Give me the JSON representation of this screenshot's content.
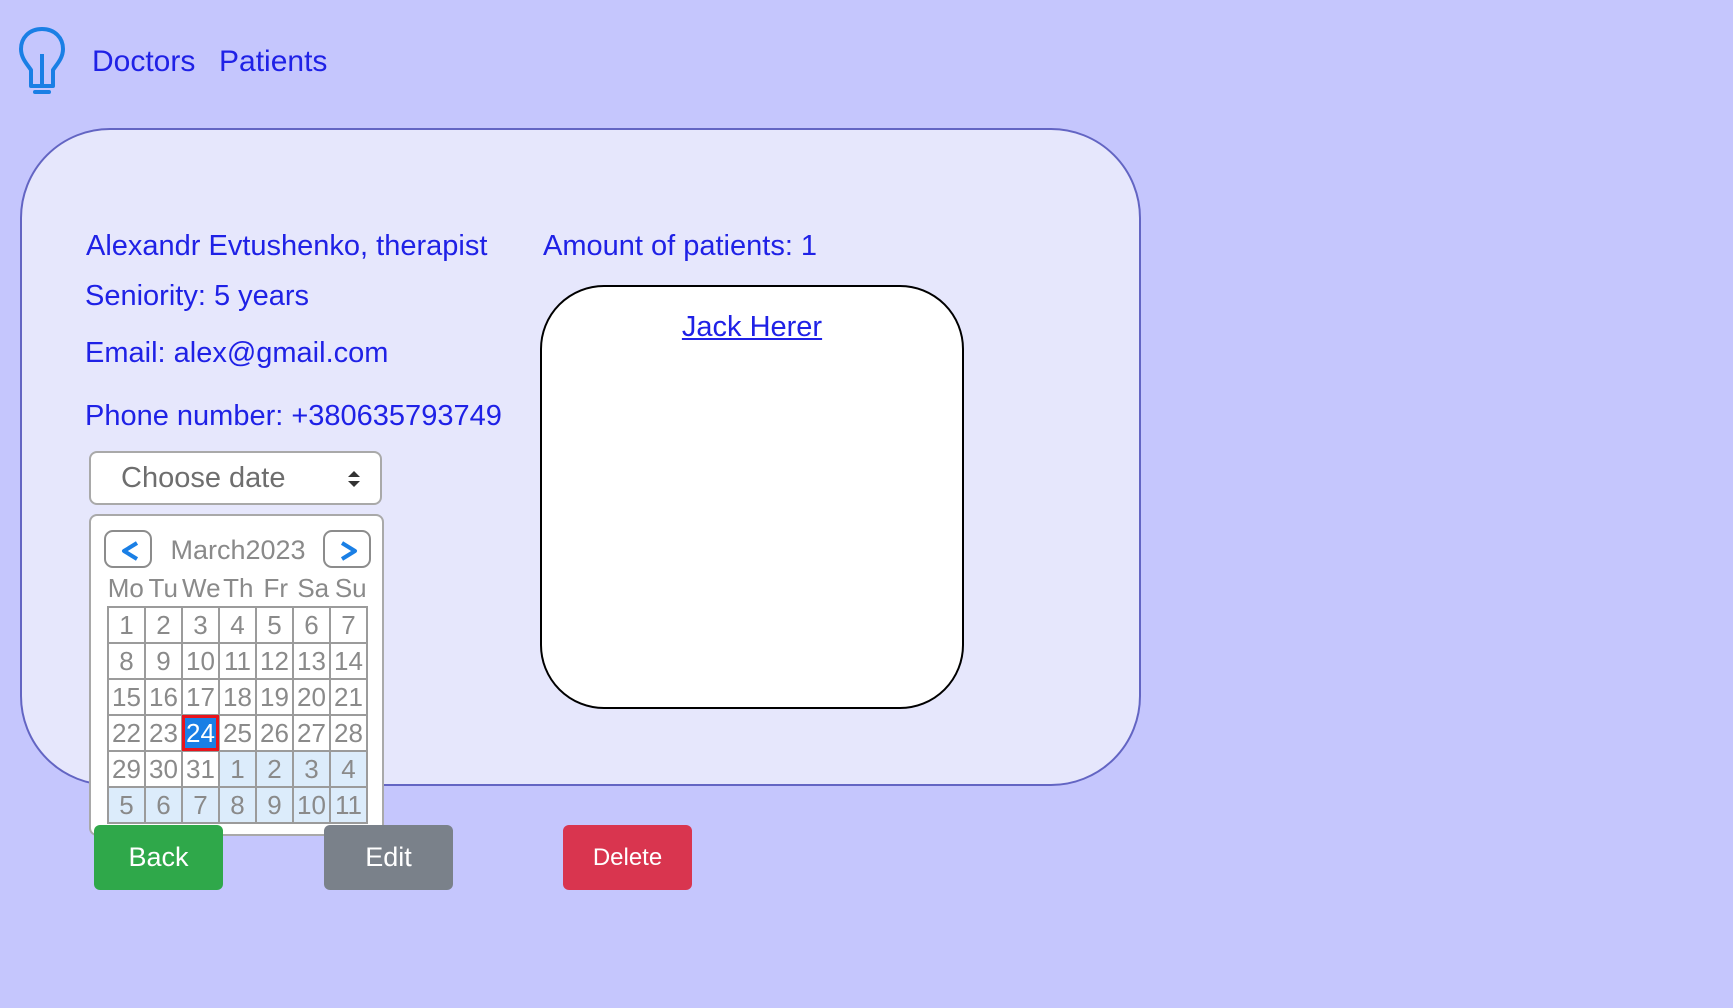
{
  "nav": {
    "logo_icon": "lightbulb-icon",
    "doctors": "Doctors",
    "patients": "Patients"
  },
  "doctor": {
    "name_line": "Alexandr Evtushenko, therapist",
    "seniority": "Seniority: 5 years",
    "email": "Email: alex@gmail.com",
    "phone": "Phone number: +380635793749"
  },
  "patients_panel": {
    "amount": "Amount of patients: 1",
    "items": [
      "Jack Herer"
    ]
  },
  "date_select": {
    "placeholder": "Choose date"
  },
  "calendar": {
    "month": "March",
    "year": "2023",
    "prev": "<",
    "next": ">",
    "weekdays": [
      "Mo",
      "Tu",
      "We",
      "Th",
      "Fr",
      "Sa",
      "Su"
    ],
    "selected_day": 24,
    "weeks": [
      [
        "1",
        "2",
        "3",
        "4",
        "5",
        "6",
        "7"
      ],
      [
        "8",
        "9",
        "10",
        "11",
        "12",
        "13",
        "14"
      ],
      [
        "15",
        "16",
        "17",
        "18",
        "19",
        "20",
        "21"
      ],
      [
        "22",
        "23",
        "24",
        "25",
        "26",
        "27",
        "28"
      ],
      [
        "29",
        "30",
        "31",
        "1",
        "2",
        "3",
        "4"
      ],
      [
        "5",
        "6",
        "7",
        "8",
        "9",
        "10",
        "11"
      ]
    ]
  },
  "buttons": {
    "back": "Back",
    "edit": "Edit",
    "delete": "Delete"
  },
  "colors": {
    "background": "#c5c6fd",
    "card": "#e6e7fc",
    "text": "#1f21e6",
    "back": "#2fa84a",
    "edit": "#7a818a",
    "delete": "#d9354f",
    "selected": "#1a7fe5"
  }
}
